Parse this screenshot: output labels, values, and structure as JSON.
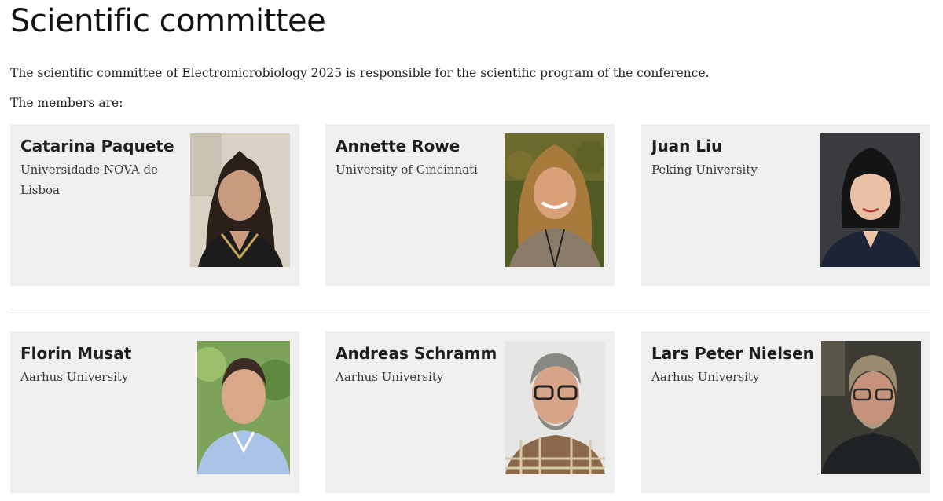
{
  "page": {
    "title": "Scientific committee",
    "intro": "The scientific committee of Electromicrobiology 2025 is responsible for the scientific program of the conference.",
    "members_label": "The members are:"
  },
  "members": [
    {
      "name": "Catarina Paquete",
      "affiliation": "Universidade NOVA de Lisboa"
    },
    {
      "name": "Annette Rowe",
      "affiliation": "University of Cincinnati"
    },
    {
      "name": "Juan Liu",
      "affiliation": "Peking University"
    },
    {
      "name": "Florin Musat",
      "affiliation": "Aarhus University"
    },
    {
      "name": "Andreas Schramm",
      "affiliation": "Aarhus University"
    },
    {
      "name": "Lars Peter Nielsen",
      "affiliation": "Aarhus University"
    }
  ],
  "colors": {
    "card_background": "#efefef",
    "divider": "#d6d6d6",
    "text": "#1a1a1a"
  }
}
